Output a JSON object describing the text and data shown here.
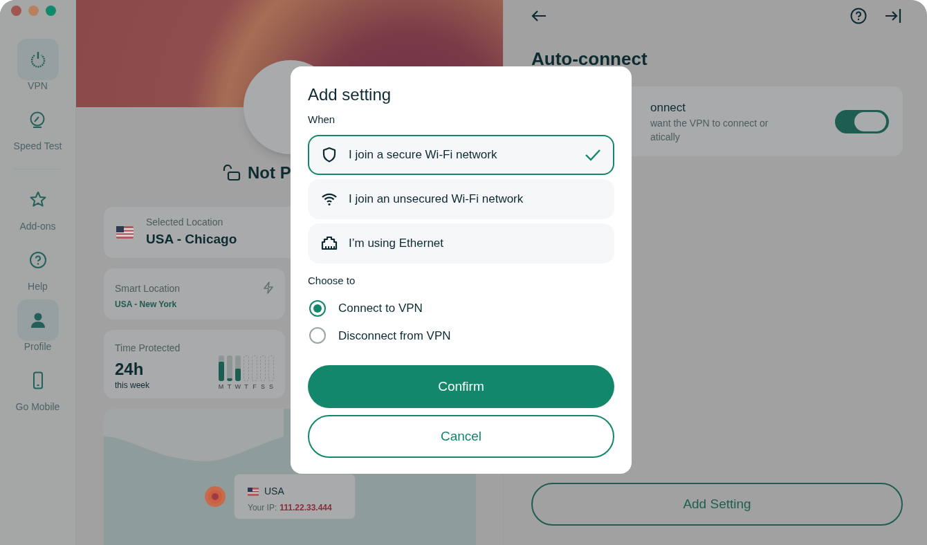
{
  "sidebar": {
    "items": [
      {
        "label": "VPN",
        "selected": true
      },
      {
        "label": "Speed Test",
        "selected": false
      },
      {
        "label": "Add-ons",
        "selected": false
      },
      {
        "label": "Help",
        "selected": false
      },
      {
        "label": "Profile",
        "selected": true
      },
      {
        "label": "Go Mobile",
        "selected": false
      }
    ]
  },
  "vpn": {
    "status": "Not P",
    "selected_location": {
      "label": "Selected Location",
      "value": "USA - Chicago"
    },
    "smart_location": {
      "label": "Smart Location",
      "value": "USA - New York"
    },
    "time_protected": {
      "label": "Time Protected",
      "value": "24h",
      "caption": "this week",
      "days": [
        {
          "label": "M",
          "level": 0.75,
          "future": false
        },
        {
          "label": "T",
          "level": 0.1,
          "future": false
        },
        {
          "label": "W",
          "level": 0.5,
          "future": false
        },
        {
          "label": "T",
          "future": true
        },
        {
          "label": "F",
          "future": true
        },
        {
          "label": "S",
          "future": true
        },
        {
          "label": "S",
          "future": true
        }
      ]
    },
    "map_tooltip": {
      "country": "USA",
      "ip_label": "Your IP:",
      "ip": "111.22.33.444"
    }
  },
  "settings": {
    "title": "Auto-connect",
    "card": {
      "title": "onnect",
      "description": [
        "want the VPN to connect or",
        "atically"
      ],
      "on": true
    },
    "add_button": "Add Setting"
  },
  "dialog": {
    "title": "Add setting",
    "when_label": "When",
    "when_options": [
      {
        "label": "I join a secure Wi-Fi network",
        "selected": true
      },
      {
        "label": "I join an unsecured Wi-Fi network",
        "selected": false
      },
      {
        "label": "I’m using Ethernet",
        "selected": false
      }
    ],
    "choose_label": "Choose to",
    "choose_options": [
      {
        "label": "Connect to VPN",
        "selected": true
      },
      {
        "label": "Disconnect from VPN",
        "selected": false
      }
    ],
    "confirm": "Confirm",
    "cancel": "Cancel"
  }
}
